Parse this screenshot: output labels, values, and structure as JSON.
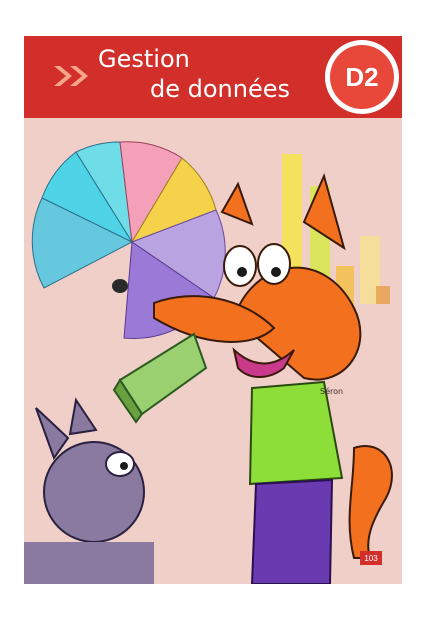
{
  "header": {
    "title_line1": "Gestion",
    "title_line2": "de données",
    "badge": "D2"
  },
  "illustration": {
    "signature": "Séron"
  },
  "footer": {
    "page_number": "103"
  },
  "colors": {
    "header_red": "#d22f2a",
    "badge_red": "#e8483a",
    "background_pink": "#f0cfc8"
  }
}
